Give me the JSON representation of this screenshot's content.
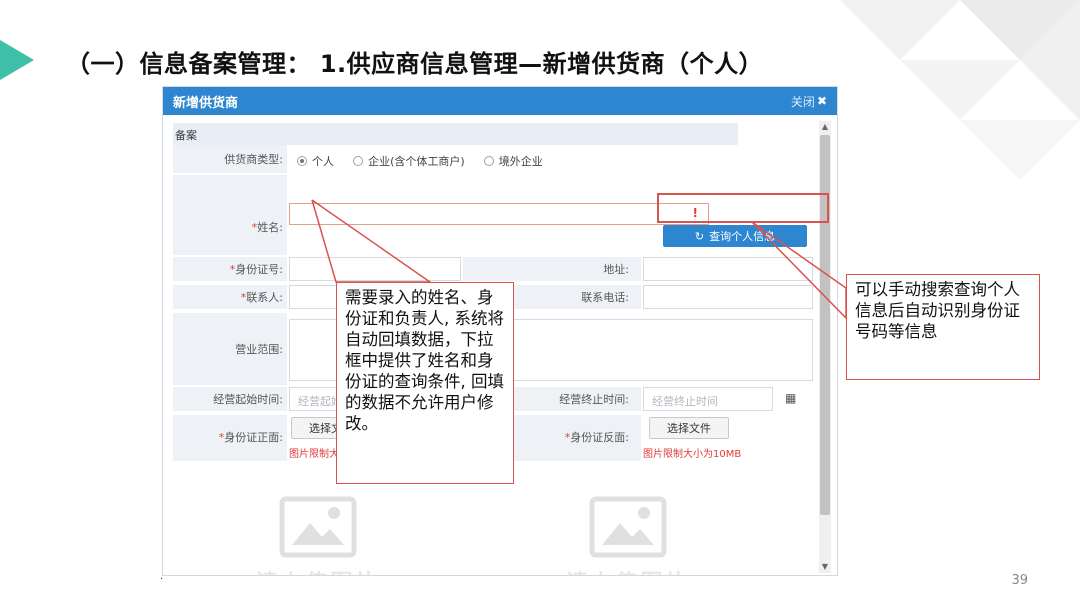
{
  "slide": {
    "title": "（一）信息备案管理： 1.供应商信息管理—新增供货商（个人）",
    "page_number": "39",
    "dot": "·",
    "accent_color": "#3dbfa8"
  },
  "dialog": {
    "title": "新增供货商",
    "close_label": "关闭",
    "close_icon": "✖",
    "section_label": "备案",
    "supplier_type": {
      "label": "供货商类型:",
      "options": [
        "个人",
        "企业(含个体工商户)",
        "境外企业"
      ],
      "selected": "个人"
    },
    "name": {
      "required": "*",
      "label": "姓名:",
      "value": "",
      "alert": "!"
    },
    "query_button": {
      "icon": "refresh-icon",
      "label": "查询个人信息"
    },
    "id_number": {
      "required": "*",
      "label": "身份证号:",
      "value": ""
    },
    "address": {
      "label": "地址:",
      "value": ""
    },
    "contact": {
      "required": "*",
      "label": "联系人:",
      "value": ""
    },
    "contact_phone": {
      "label": "联系电话:",
      "value": ""
    },
    "business_scope": {
      "label": "营业范围:",
      "value": ""
    },
    "start_time": {
      "label": "经营起始时间:",
      "placeholder": "经营起始时间"
    },
    "end_time": {
      "label": "经营终止时间:",
      "placeholder": "经营终止时间"
    },
    "id_front": {
      "required": "*",
      "label": "身份证正面:",
      "button": "选择文件",
      "limit": "图片限制大小为10MB"
    },
    "id_back": {
      "required": "*",
      "label": "身份证反面:",
      "button": "选择文件",
      "limit": "图片限制大小为10MB"
    },
    "upload_placeholder_text": "请上传图片"
  },
  "callouts": {
    "left": "需要录入的姓名、身份证和负责人, 系统将自动回填数据，下拉框中提供了姓名和身份证的查询条件, 回填的数据不允许用户修改。",
    "right": "可以手动搜索查询个人信息后自动识别身份证号码等信息",
    "border_color": "#d9534f"
  }
}
